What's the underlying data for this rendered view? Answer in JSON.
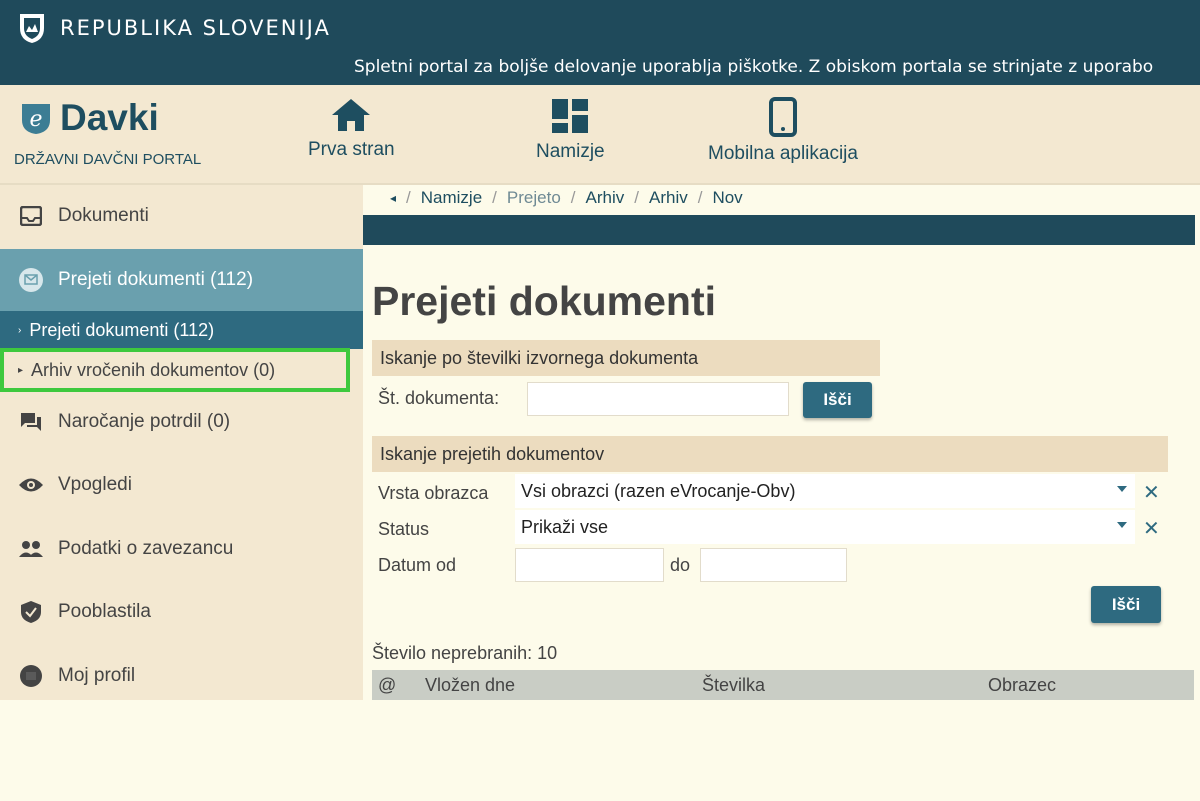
{
  "topbar": {
    "country": "REPUBLIKA SLOVENIJA",
    "cookie_notice": "Spletni portal za boljše delovanje uporablja piškotke. Z obiskom portala se strinjate z uporabo"
  },
  "header": {
    "logo": "Davki",
    "portal": "DRŽAVNI DAVČNI PORTAL",
    "nav": [
      {
        "label": "Prva stran",
        "icon": "home-icon"
      },
      {
        "label": "Namizje",
        "icon": "dashboard-icon"
      },
      {
        "label": "Mobilna aplikacija",
        "icon": "mobile-icon"
      }
    ]
  },
  "sidebar": {
    "items": [
      {
        "label": "Dokumenti",
        "icon": "inbox-icon"
      },
      {
        "label": "Prejeti dokumenti (112)",
        "icon": "mail-icon"
      },
      {
        "label": "Naročanje potrdil (0)",
        "icon": "chat-icon"
      },
      {
        "label": "Vpogledi",
        "icon": "eye-icon"
      },
      {
        "label": "Podatki o zavezancu",
        "icon": "people-icon"
      },
      {
        "label": "Pooblastila",
        "icon": "shield-icon"
      },
      {
        "label": "Moj profil",
        "icon": "profile-icon"
      }
    ],
    "subitems": [
      {
        "label": "Prejeti dokumenti (112)"
      },
      {
        "label": "Arhiv vročenih dokumentov (0)"
      }
    ]
  },
  "breadcrumb": [
    "Namizje",
    "Prejeto",
    "Arhiv",
    "Arhiv",
    "Nov"
  ],
  "main": {
    "title": "Prejeti dokumenti",
    "section1": {
      "heading": "Iskanje po številki izvornega dokumenta",
      "doc_label": "Št. dokumenta:",
      "search_btn": "Išči"
    },
    "section2": {
      "heading": "Iskanje prejetih dokumentov",
      "form_label": "Vrsta obrazca",
      "form_value": "Vsi obrazci (razen eVrocanje-Obv)",
      "status_label": "Status",
      "status_value": "Prikaži vse",
      "date_label": "Datum od",
      "date_to_label": "do",
      "search_btn": "Išči",
      "clear_glyph": "✕"
    },
    "unread": "Število neprebranih: 10",
    "table_headers": [
      "@",
      "Vložen dne",
      "Številka",
      "Obrazec"
    ]
  },
  "colors": {
    "primary_dark": "#1f4a5b",
    "accent": "#2e6a80",
    "highlight": "#3ec93e"
  }
}
